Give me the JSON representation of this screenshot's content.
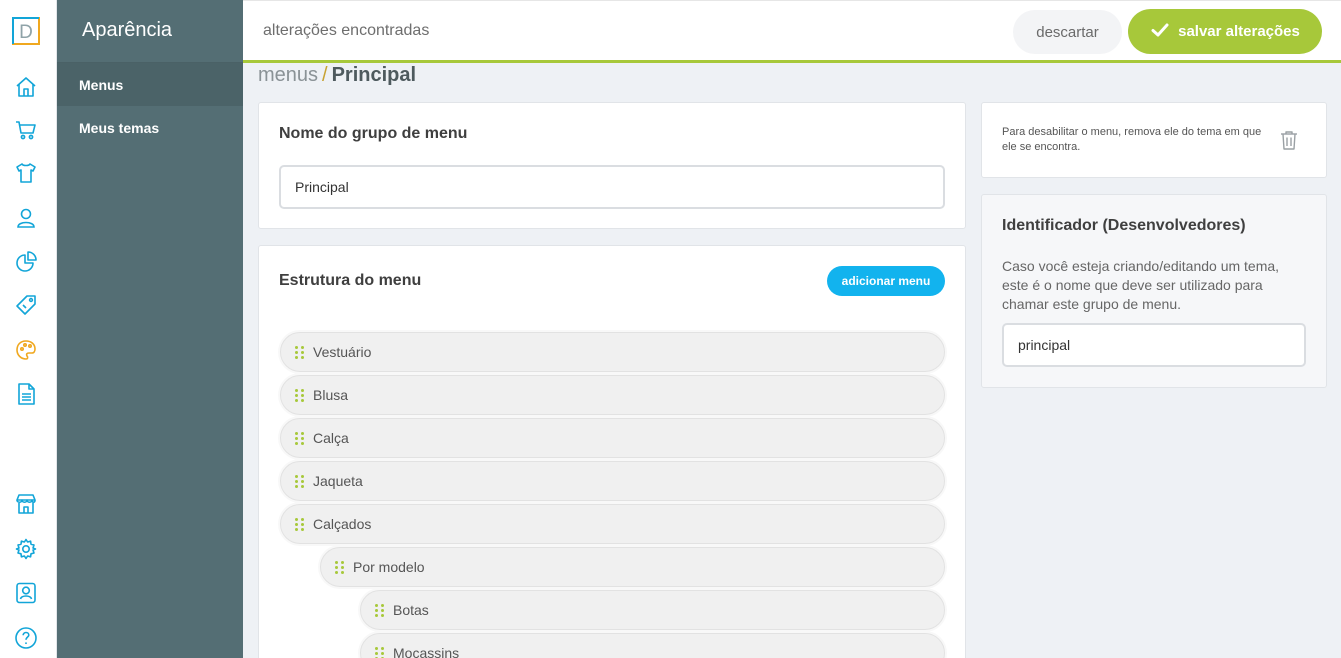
{
  "logo": {
    "letter": "D"
  },
  "rail": {
    "icons": [
      "home-icon",
      "cart-icon",
      "shirt-icon",
      "user-icon",
      "pie-chart-icon",
      "tags-icon",
      "palette-icon",
      "document-icon",
      "store-icon",
      "gear-icon",
      "user-card-icon",
      "help-icon"
    ]
  },
  "sidebar": {
    "title": "Aparência",
    "items": [
      {
        "label": "Menus",
        "active": true
      },
      {
        "label": "Meus temas",
        "active": false
      }
    ]
  },
  "topbar": {
    "status": "alterações encontradas",
    "discard_label": "descartar",
    "save_label": "salvar alterações"
  },
  "breadcrumb": {
    "parent": "menus",
    "separator": "/",
    "current": "Principal"
  },
  "group_name_card": {
    "title": "Nome do grupo de menu",
    "value": "Principal"
  },
  "structure_card": {
    "title": "Estrutura do menu",
    "add_label": "adicionar menu",
    "items": [
      {
        "label": "Vestuário",
        "level": 0
      },
      {
        "label": "Blusa",
        "level": 0
      },
      {
        "label": "Calça",
        "level": 0
      },
      {
        "label": "Jaqueta",
        "level": 0
      },
      {
        "label": "Calçados",
        "level": 0
      },
      {
        "label": "Por modelo",
        "level": 1
      },
      {
        "label": "Botas",
        "level": 2
      },
      {
        "label": "Mocassins",
        "level": 2
      }
    ]
  },
  "disable_card": {
    "note": "Para desabilitar o menu, remova ele do tema em que ele se encontra."
  },
  "identifier_card": {
    "title": "Identificador (Desenvolvedores)",
    "description": "Caso você esteja criando/editando um tema, este é o nome que deve ser utilizado para chamar este grupo de menu.",
    "value": "principal"
  },
  "colors": {
    "accent_green": "#a7c83a",
    "accent_blue": "#12b3ee",
    "sidebar": "#546e74",
    "rail_icon": "#12a5d8"
  }
}
